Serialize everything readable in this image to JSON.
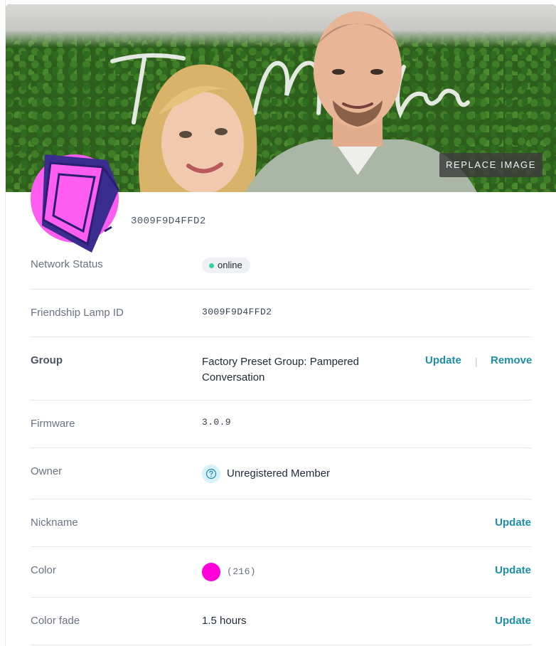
{
  "header": {
    "replace_image_label": "REPLACE IMAGE",
    "device_id": "3009F9D4FFD2",
    "neon_text": "The Mullens"
  },
  "rows": {
    "network_status": {
      "label": "Network Status",
      "value": "online",
      "status_color": "#34d399"
    },
    "lamp_id": {
      "label": "Friendship Lamp ID",
      "value": "3009F9D4FFD2"
    },
    "group": {
      "label": "Group",
      "value_line1": "Factory Preset Group: Pampered",
      "value_line2": "Conversation",
      "update_label": "Update",
      "separator": "|",
      "remove_label": "Remove"
    },
    "firmware": {
      "label": "Firmware",
      "value": "3.0.9"
    },
    "owner": {
      "label": "Owner",
      "value": "Unregistered Member",
      "icon": "question-circle-icon"
    },
    "nickname": {
      "label": "Nickname",
      "value": "",
      "update_label": "Update"
    },
    "color": {
      "label": "Color",
      "value": "(216)",
      "swatch": "#ff00d8",
      "update_label": "Update"
    },
    "color_fade": {
      "label": "Color fade",
      "value": "1.5 hours",
      "update_label": "Update"
    }
  },
  "theme": {
    "accent": "#1b8fa6",
    "avatar_fill": "#ff5cf2",
    "avatar_frame": "#3b2d8f"
  }
}
